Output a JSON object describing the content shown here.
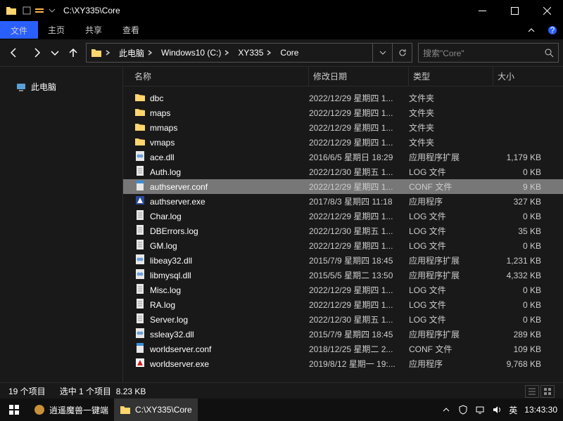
{
  "window_title": "C:\\XY335\\Core",
  "tabs": {
    "file": "文件",
    "home": "主页",
    "share": "共享",
    "view": "查看"
  },
  "breadcrumbs": [
    "此电脑",
    "Windows10 (C:)",
    "XY335",
    "Core"
  ],
  "search_placeholder": "搜索\"Core\"",
  "nav_item": "此电脑",
  "columns": {
    "name": "名称",
    "date": "修改日期",
    "type": "类型",
    "size": "大小"
  },
  "files": [
    {
      "name": "dbc",
      "date": "2022/12/29 星期四 1...",
      "type": "文件夹",
      "size": "",
      "icon": "folder"
    },
    {
      "name": "maps",
      "date": "2022/12/29 星期四 1...",
      "type": "文件夹",
      "size": "",
      "icon": "folder"
    },
    {
      "name": "mmaps",
      "date": "2022/12/29 星期四 1...",
      "type": "文件夹",
      "size": "",
      "icon": "folder"
    },
    {
      "name": "vmaps",
      "date": "2022/12/29 星期四 1...",
      "type": "文件夹",
      "size": "",
      "icon": "folder"
    },
    {
      "name": "ace.dll",
      "date": "2016/6/5 星期日 18:29",
      "type": "应用程序扩展",
      "size": "1,179 KB",
      "icon": "dll"
    },
    {
      "name": "Auth.log",
      "date": "2022/12/30 星期五 1...",
      "type": "LOG 文件",
      "size": "0 KB",
      "icon": "file"
    },
    {
      "name": "authserver.conf",
      "date": "2022/12/29 星期四 1...",
      "type": "CONF 文件",
      "size": "9 KB",
      "icon": "conf",
      "selected": true
    },
    {
      "name": "authserver.exe",
      "date": "2017/8/3 星期四 11:18",
      "type": "应用程序",
      "size": "327 KB",
      "icon": "exe"
    },
    {
      "name": "Char.log",
      "date": "2022/12/29 星期四 1...",
      "type": "LOG 文件",
      "size": "0 KB",
      "icon": "file"
    },
    {
      "name": "DBErrors.log",
      "date": "2022/12/30 星期五 1...",
      "type": "LOG 文件",
      "size": "35 KB",
      "icon": "file"
    },
    {
      "name": "GM.log",
      "date": "2022/12/29 星期四 1...",
      "type": "LOG 文件",
      "size": "0 KB",
      "icon": "file"
    },
    {
      "name": "libeay32.dll",
      "date": "2015/7/9 星期四 18:45",
      "type": "应用程序扩展",
      "size": "1,231 KB",
      "icon": "dll"
    },
    {
      "name": "libmysql.dll",
      "date": "2015/5/5 星期二 13:50",
      "type": "应用程序扩展",
      "size": "4,332 KB",
      "icon": "dll"
    },
    {
      "name": "Misc.log",
      "date": "2022/12/29 星期四 1...",
      "type": "LOG 文件",
      "size": "0 KB",
      "icon": "file"
    },
    {
      "name": "RA.log",
      "date": "2022/12/29 星期四 1...",
      "type": "LOG 文件",
      "size": "0 KB",
      "icon": "file"
    },
    {
      "name": "Server.log",
      "date": "2022/12/30 星期五 1...",
      "type": "LOG 文件",
      "size": "0 KB",
      "icon": "file"
    },
    {
      "name": "ssleay32.dll",
      "date": "2015/7/9 星期四 18:45",
      "type": "应用程序扩展",
      "size": "289 KB",
      "icon": "dll"
    },
    {
      "name": "worldserver.conf",
      "date": "2018/12/25 星期二 2...",
      "type": "CONF 文件",
      "size": "109 KB",
      "icon": "conf"
    },
    {
      "name": "worldserver.exe",
      "date": "2019/8/12 星期一 19:...",
      "type": "应用程序",
      "size": "9,768 KB",
      "icon": "exe2"
    }
  ],
  "status": {
    "count": "19 个项目",
    "selection": "选中 1 个项目",
    "selsize": "8.23 KB"
  },
  "taskbar": {
    "app1": "逍遥魔兽一键端",
    "app2": "C:\\XY335\\Core",
    "ime": "英",
    "time": "13:43:30"
  }
}
